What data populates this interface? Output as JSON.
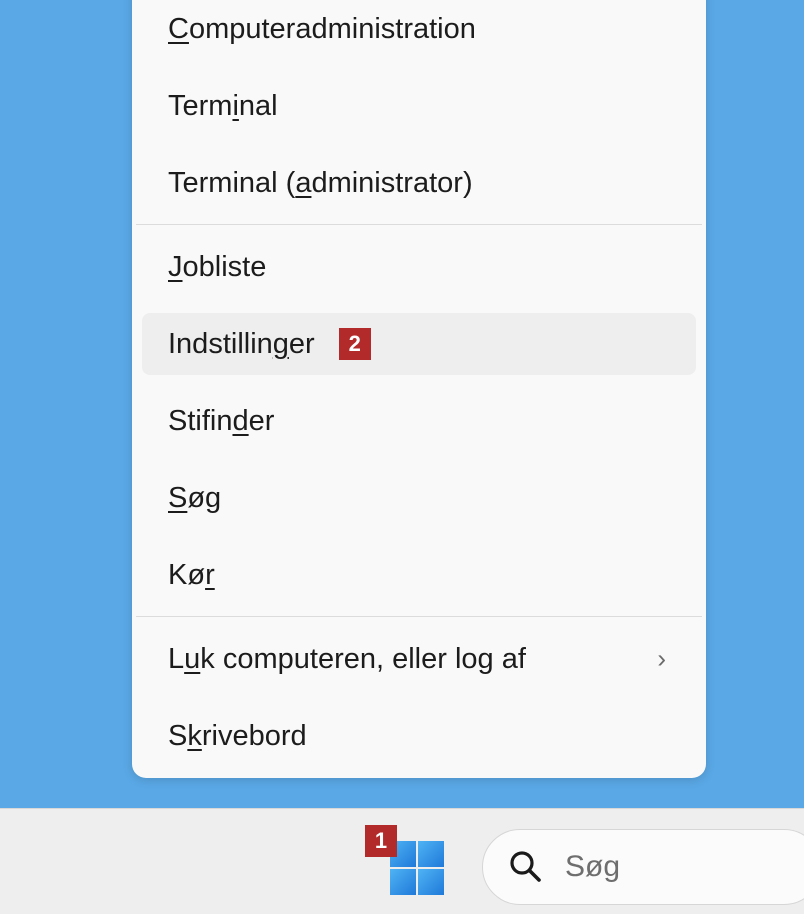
{
  "menu": {
    "items": [
      {
        "id": "computeradministration",
        "pre": "",
        "u": "C",
        "post": "omputeradministration"
      },
      {
        "id": "terminal",
        "pre": "Term",
        "u": "i",
        "post": "nal"
      },
      {
        "id": "terminal-admin",
        "pre": "Terminal (",
        "u": "a",
        "post": "dministrator)"
      },
      {
        "id": "jobliste",
        "pre": "",
        "u": "J",
        "post": "obliste"
      },
      {
        "id": "indstillinger",
        "pre": "Indstillin",
        "u": "g",
        "post": "er"
      },
      {
        "id": "stifinder",
        "pre": "Stifin",
        "u": "d",
        "post": "er"
      },
      {
        "id": "sog",
        "pre": "",
        "u": "S",
        "post": "øg"
      },
      {
        "id": "kor",
        "pre": "Kø",
        "u": "r",
        "post": ""
      },
      {
        "id": "luk",
        "pre": "L",
        "u": "u",
        "post": "k computeren, eller log af"
      },
      {
        "id": "skrivebord",
        "pre": "S",
        "u": "k",
        "post": "rivebord"
      }
    ],
    "submenu_chevron": "›"
  },
  "callouts": {
    "start": "1",
    "settings": "2"
  },
  "taskbar": {
    "search_placeholder": "Søg",
    "search_icon": "search-icon",
    "start_icon": "windows-logo-icon"
  },
  "colors": {
    "desktop": "#5aa8e6",
    "menu_bg": "#f9f9f9",
    "hover_bg": "#eeeeee",
    "callout": "#b32a2a",
    "win_logo": "#3a8ee6"
  }
}
